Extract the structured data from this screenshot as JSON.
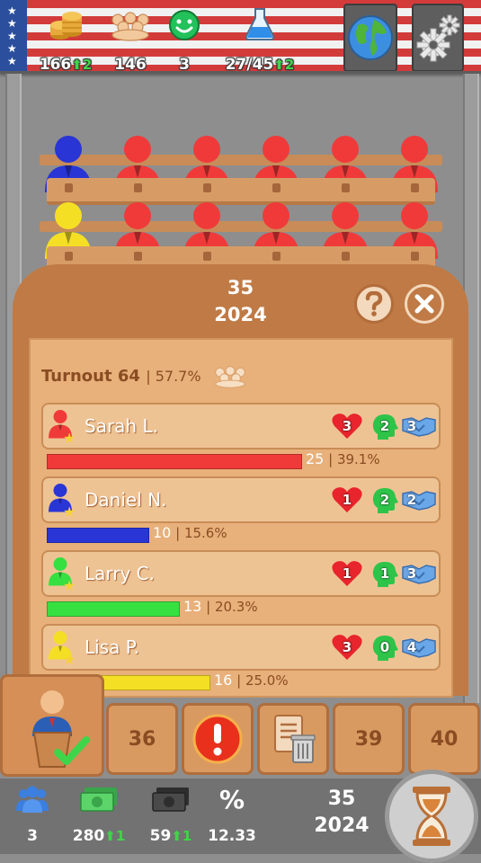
{
  "topbar": {
    "coins": {
      "value": "166",
      "delta": "2",
      "icon": "coin-stack-icon"
    },
    "supporters": {
      "value": "146",
      "icon": "crowd-icon"
    },
    "happiness": {
      "value": "3",
      "icon": "smiley-icon"
    },
    "research": {
      "value": "27/45",
      "delta": "2",
      "icon": "flask-icon"
    },
    "map_button": {
      "icon": "globe-icon"
    },
    "settings_button": {
      "icon": "gear-icon"
    }
  },
  "colors": {
    "red": "#f03a3a",
    "blue": "#2a35d6",
    "green": "#36e041",
    "yellow": "#f5df25",
    "panel": "#c07a45",
    "panel_inner": "#e8b07a"
  },
  "chamber": {
    "rows": [
      [
        "blue",
        "red",
        "red",
        "red",
        "red",
        "red"
      ],
      [
        "yellow",
        "red",
        "red",
        "red",
        "red",
        "red"
      ]
    ]
  },
  "election": {
    "week": "35",
    "year": "2024",
    "help_icon": "question-icon",
    "close_icon": "close-icon",
    "turnout_label": "Turnout",
    "turnout_value": "64",
    "turnout_pct": "57.7%",
    "candidates": [
      {
        "name": "Sarah L.",
        "color": "red",
        "hearts": "3",
        "heads": "2",
        "deals": "3",
        "votes": "25",
        "pct": "39.1%",
        "share": 0.391
      },
      {
        "name": "Daniel N.",
        "color": "blue",
        "hearts": "1",
        "heads": "2",
        "deals": "2",
        "votes": "10",
        "pct": "15.6%",
        "share": 0.156
      },
      {
        "name": "Larry C.",
        "color": "green",
        "hearts": "1",
        "heads": "1",
        "deals": "3",
        "votes": "13",
        "pct": "20.3%",
        "share": 0.203
      },
      {
        "name": "Lisa P.",
        "color": "yellow",
        "hearts": "3",
        "heads": "0",
        "deals": "4",
        "votes": "16",
        "pct": "25.0%",
        "share": 0.25
      }
    ]
  },
  "actions": {
    "vote_icon": "politician-podium-check-icon",
    "week_36": "36",
    "alert_icon": "alert-icon",
    "discard_icon": "document-trash-icon",
    "week_39": "39",
    "week_40": "40"
  },
  "bottombar": {
    "members": {
      "value": "3",
      "icon": "people-icon"
    },
    "money": {
      "value": "280",
      "delta": "1",
      "icon": "cash-icon"
    },
    "expenses": {
      "value": "59",
      "delta": "1",
      "icon": "dark-cash-icon"
    },
    "tax": {
      "value": "12.33",
      "icon": "percent-icon",
      "symbol": "%"
    },
    "week": "35",
    "year": "2024",
    "end_turn_icon": "hourglass-icon"
  }
}
